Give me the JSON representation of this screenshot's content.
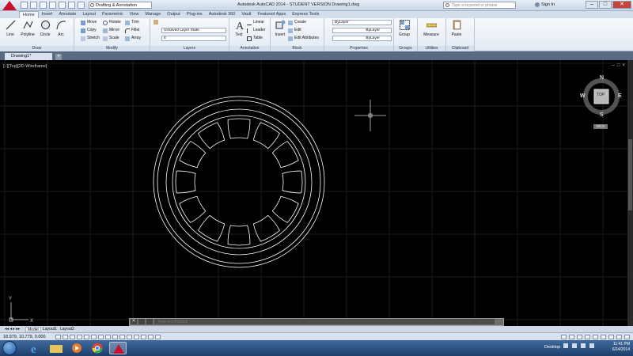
{
  "titlebar": {
    "title": "Autodesk AutoCAD 2014 - STUDENT VERSION    Drawing1.dwg",
    "workspace": "Drafting & Annotation",
    "search_placeholder": "Type a keyword or phrase",
    "signin": "Sign In"
  },
  "ribbon_tabs": [
    "Home",
    "Insert",
    "Annotate",
    "Layout",
    "Parametric",
    "View",
    "Manage",
    "Output",
    "Plug-ins",
    "Autodesk 360",
    "Vault",
    "Featured Apps",
    "Express Tools"
  ],
  "ribbon": {
    "draw": {
      "title": "Draw",
      "line": "Line",
      "polyline": "Polyline",
      "circle": "Circle",
      "arc": "Arc"
    },
    "modify": {
      "title": "Modify",
      "move": "Move",
      "rotate": "Rotate",
      "trim": "Trim",
      "copy": "Copy",
      "mirror": "Mirror",
      "fillet": "Fillet",
      "stretch": "Stretch",
      "scale": "Scale",
      "array": "Array"
    },
    "layers": {
      "title": "Layers",
      "state": "Unsaved Layer State",
      "current": "0"
    },
    "annotation": {
      "title": "Annotation",
      "text": "Text",
      "linear": "Linear",
      "leader": "Leader",
      "table": "Table"
    },
    "block": {
      "title": "Block",
      "insert": "Insert",
      "create": "Create",
      "edit": "Edit",
      "edit_attributes": "Edit Attributes"
    },
    "properties": {
      "title": "Properties",
      "color": "ByLayer",
      "linetype": "ByLayer",
      "lineweight": "ByLayer"
    },
    "groups": {
      "title": "Groups",
      "group": "Group"
    },
    "utilities": {
      "title": "Utilities",
      "measure": "Measure"
    },
    "clipboard": {
      "title": "Clipboard",
      "paste": "Paste"
    }
  },
  "file_tab": "Drawing1*",
  "viewport": {
    "label": "[−][Top][2D Wireframe]",
    "viewcube": {
      "top": "TOP",
      "n": "N",
      "s": "S",
      "e": "E",
      "w": "W",
      "wcs": "WCS"
    }
  },
  "command_line": {
    "placeholder": "Type a command"
  },
  "layout_tabs": [
    "Model",
    "Layout1",
    "Layout2"
  ],
  "statusbar": {
    "coords": "18.979, 10.779, 0.000"
  },
  "taskbar": {
    "desktop": "Desktop",
    "time": "11:41 PM",
    "date": "6/24/2014"
  },
  "colors": {
    "accent": "#c8102e",
    "background": "#000000",
    "drawing_stroke": "#ffffff"
  },
  "icons": [
    "autocad-logo-icon",
    "save-icon",
    "open-icon",
    "undo-icon",
    "redo-icon",
    "gear-icon",
    "search-icon",
    "user-icon",
    "start-icon",
    "ie-icon",
    "explorer-icon",
    "media-icon",
    "chrome-icon",
    "autocad-task-icon"
  ]
}
